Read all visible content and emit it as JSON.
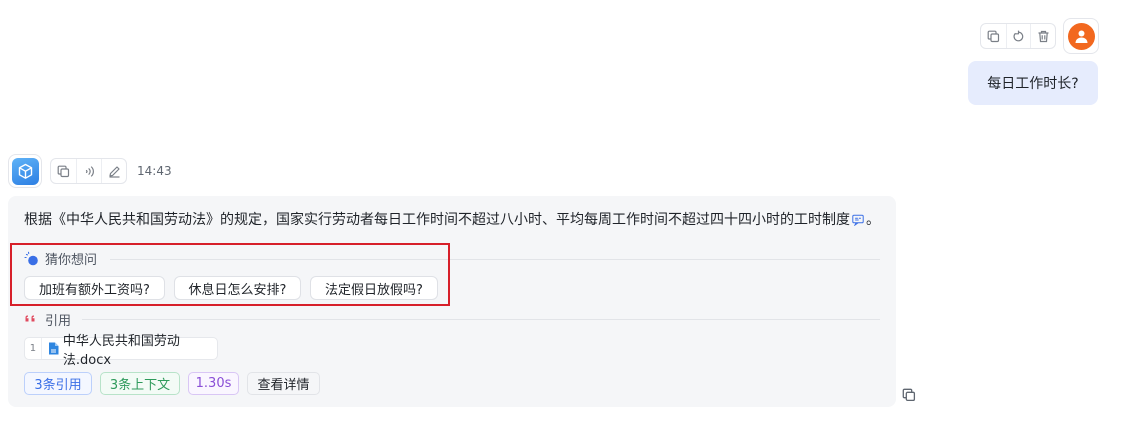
{
  "user": {
    "message": "每日工作时长?",
    "actions": [
      "copy-icon",
      "refresh-icon",
      "trash-icon"
    ],
    "avatar_color": "#f2681f"
  },
  "bot": {
    "time": "14:43",
    "actions": [
      "copy-icon",
      "speaker-icon",
      "edit-icon"
    ],
    "answer": "根据《中华人民共和国劳动法》的规定，国家实行劳动者每日工作时间不超过八小时、平均每周工作时间不超过四十四小时的工时制度",
    "answer_end": "。",
    "guess": {
      "title": "猜你想问",
      "questions": [
        "加班有额外工资吗?",
        "休息日怎么安排?",
        "法定假日放假吗?"
      ]
    },
    "reference": {
      "title": "引用",
      "items": [
        {
          "index": "1",
          "name": "中华人民共和国劳动法.docx"
        }
      ]
    },
    "tags": {
      "citations": "3条引用",
      "context": "3条上下文",
      "duration": "1.30s",
      "details": "查看详情"
    }
  },
  "colors": {
    "user_bubble": "#e6ecfd",
    "card_bg": "#f5f6f8",
    "highlight": "#d71f2a",
    "accent_blue": "#3a6fe6",
    "quote_red": "#e04a5f"
  }
}
